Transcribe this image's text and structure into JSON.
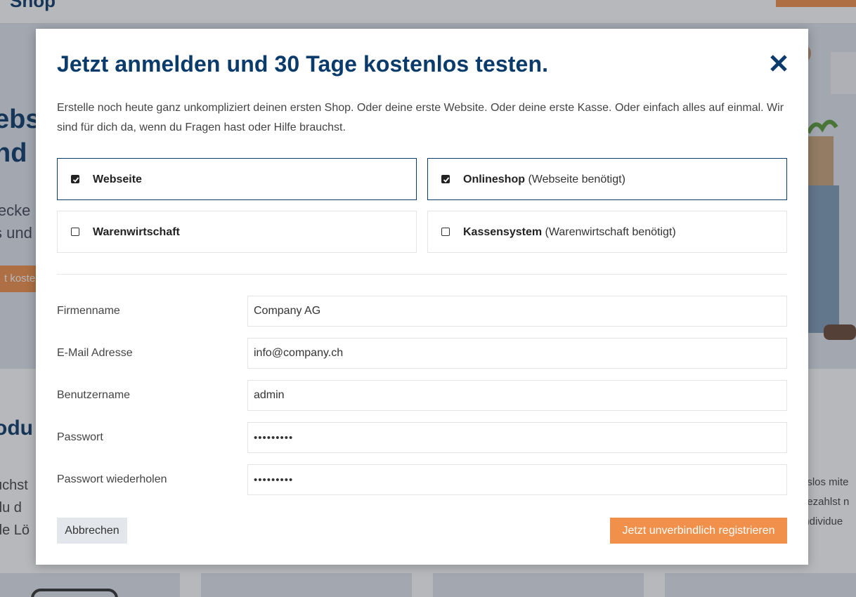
{
  "background": {
    "logo_text": "Shop",
    "hero_title_lines": [
      "ebs",
      "nd I"
    ],
    "hero_text_lines": [
      "lecke",
      "s und"
    ],
    "hero_button": "t kosten",
    "section_title": "odu",
    "section_text_lines": [
      "uchst",
      "du d",
      "de Lö"
    ],
    "section_right_lines": [
      "gslos mite",
      "bezahlst n",
      "individue"
    ]
  },
  "modal": {
    "title": "Jetzt anmelden und 30 Tage kostenlos testen.",
    "close_icon": "close-icon",
    "intro": "Erstelle noch heute ganz unkompliziert deinen ersten Shop. Oder deine erste Website. Oder deine erste Kasse. Oder einfach alles auf ein­mal. Wir sind für dich da, wenn du Fragen hast oder Hilfe brauchst.",
    "options": [
      {
        "label": "Webseite",
        "note": "",
        "checked": true
      },
      {
        "label": "Onlineshop",
        "note": "(Webseite benötigt)",
        "checked": true
      },
      {
        "label": "Warenwirtschaft",
        "note": "",
        "checked": false
      },
      {
        "label": "Kassensystem",
        "note": "(Warenwirtschaft benötigt)",
        "checked": false
      }
    ],
    "fields": [
      {
        "label": "Firmenname",
        "value": "Company AG"
      },
      {
        "label": "E-Mail Adresse",
        "value": "info@company.ch"
      },
      {
        "label": "Benutzername",
        "value": "admin"
      },
      {
        "label": "Passwort",
        "value": "•••••••••"
      },
      {
        "label": "Passwort wiederholen",
        "value": "•••••••••"
      }
    ],
    "cancel_label": "Abbrechen",
    "submit_label": "Jetzt unverbindlich registrieren"
  },
  "colors": {
    "brand_blue": "#0b3b6b",
    "accent_orange": "#f0904a",
    "cancel_bg": "#e3e7ec"
  }
}
